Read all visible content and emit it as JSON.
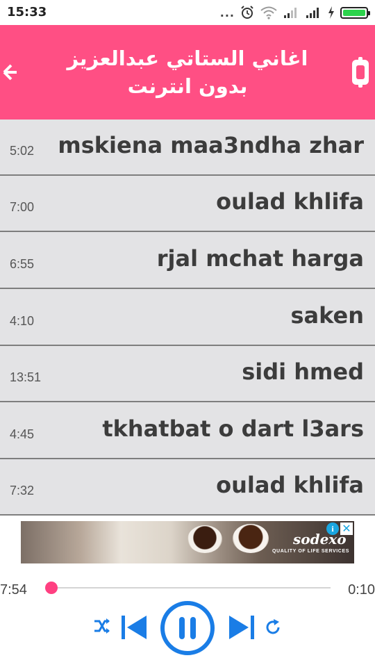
{
  "status_bar": {
    "time": "15:33",
    "dots": "...",
    "battery_color": "#2dd34c"
  },
  "header": {
    "title": "اغاني الستاتي عبدالعزيز بدون انترنت",
    "background": "#ff4f84",
    "back_icon": "back-arrow-icon",
    "menu_icon": "overflow-menu-icon"
  },
  "songs": [
    {
      "title": "mskiena maa3ndha zhar",
      "duration": "5:02"
    },
    {
      "title": "oulad khlifa",
      "duration": "7:00"
    },
    {
      "title": "rjal mchat harga",
      "duration": "6:55"
    },
    {
      "title": "saken",
      "duration": "4:10"
    },
    {
      "title": "sidi hmed",
      "duration": "13:51"
    },
    {
      "title": "tkhatbat o dart l3ars",
      "duration": "4:45"
    },
    {
      "title": "oulad khlifa",
      "duration": "7:32"
    }
  ],
  "ad": {
    "brand": "sodexo",
    "tagline": "QUALITY OF LIFE SERVICES",
    "info_label": "i",
    "close_label": "✕"
  },
  "player": {
    "elapsed": "7:54",
    "total": "0:10",
    "progress": 0.0,
    "accent_color": "#ff4081",
    "control_color": "#1a7de6",
    "controls": [
      "shuffle-icon",
      "previous-icon",
      "pause-icon",
      "next-icon",
      "repeat-icon"
    ]
  }
}
